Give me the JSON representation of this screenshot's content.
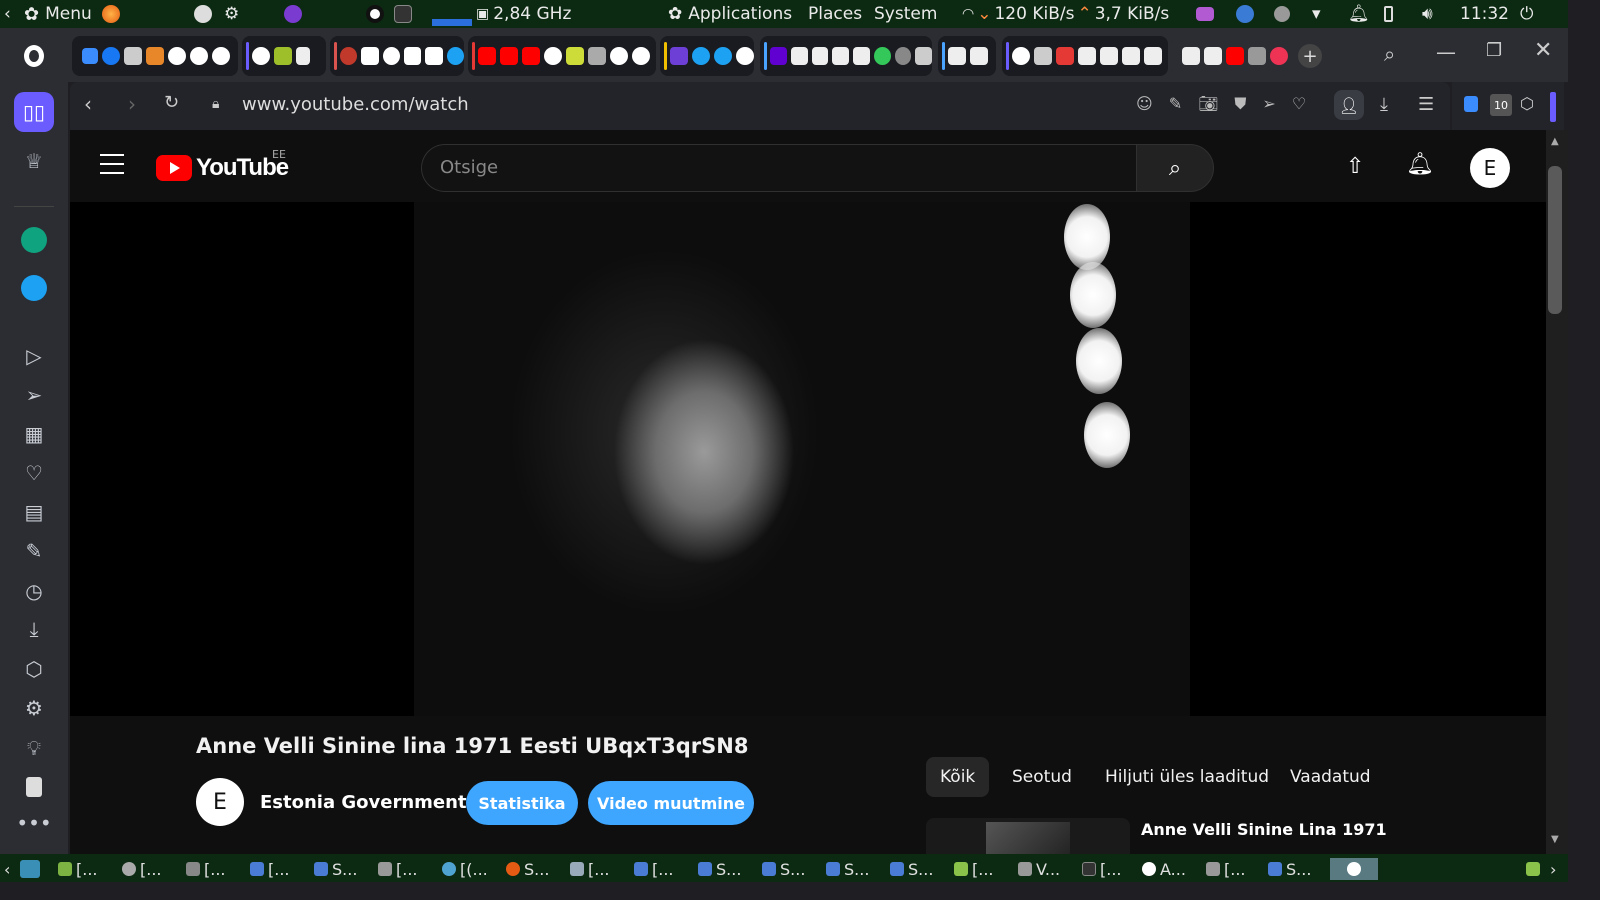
{
  "system_panel": {
    "menu_label": "Menu",
    "cpu_freq": "2,84 GHz",
    "applications": "Applications",
    "places": "Places",
    "system": "System",
    "net_down": "120 KiB/s",
    "net_up": "3,7 KiB/s",
    "clock": "11:32"
  },
  "browser": {
    "url": "www.youtube.com/watch",
    "sidebar_badge": "10",
    "colors": {
      "accent": "#6b5cff",
      "panel_green": "#0c2a12"
    }
  },
  "youtube": {
    "logo_text": "YouTube",
    "region": "EE",
    "search_placeholder": "Otsige",
    "avatar_letter": "E",
    "video_title": "Anne Velli Sinine lina 1971 Eesti UBqxT3qrSN8",
    "channel_avatar_letter": "E",
    "channel_name": "Estonia Government",
    "btn_stats": "Statistika",
    "btn_edit": "Video muutmine",
    "chips": [
      "Kõik",
      "Seotud",
      "Hiljuti üles laaditud",
      "Vaadatud"
    ],
    "rec_title": "Anne Velli Sinine Lina 1971",
    "colors": {
      "blue_button": "#3ea6ff",
      "logo_red": "#ff0000"
    }
  },
  "taskbar": {
    "items": [
      "[...",
      "[...",
      "[...",
      "[...",
      "S...",
      "[...",
      "[(...",
      "S...",
      "[...",
      "[...",
      "S...",
      "S...",
      "S...",
      "S...",
      "[...",
      "V...",
      "[...",
      "A...",
      "[...",
      "S..."
    ]
  }
}
